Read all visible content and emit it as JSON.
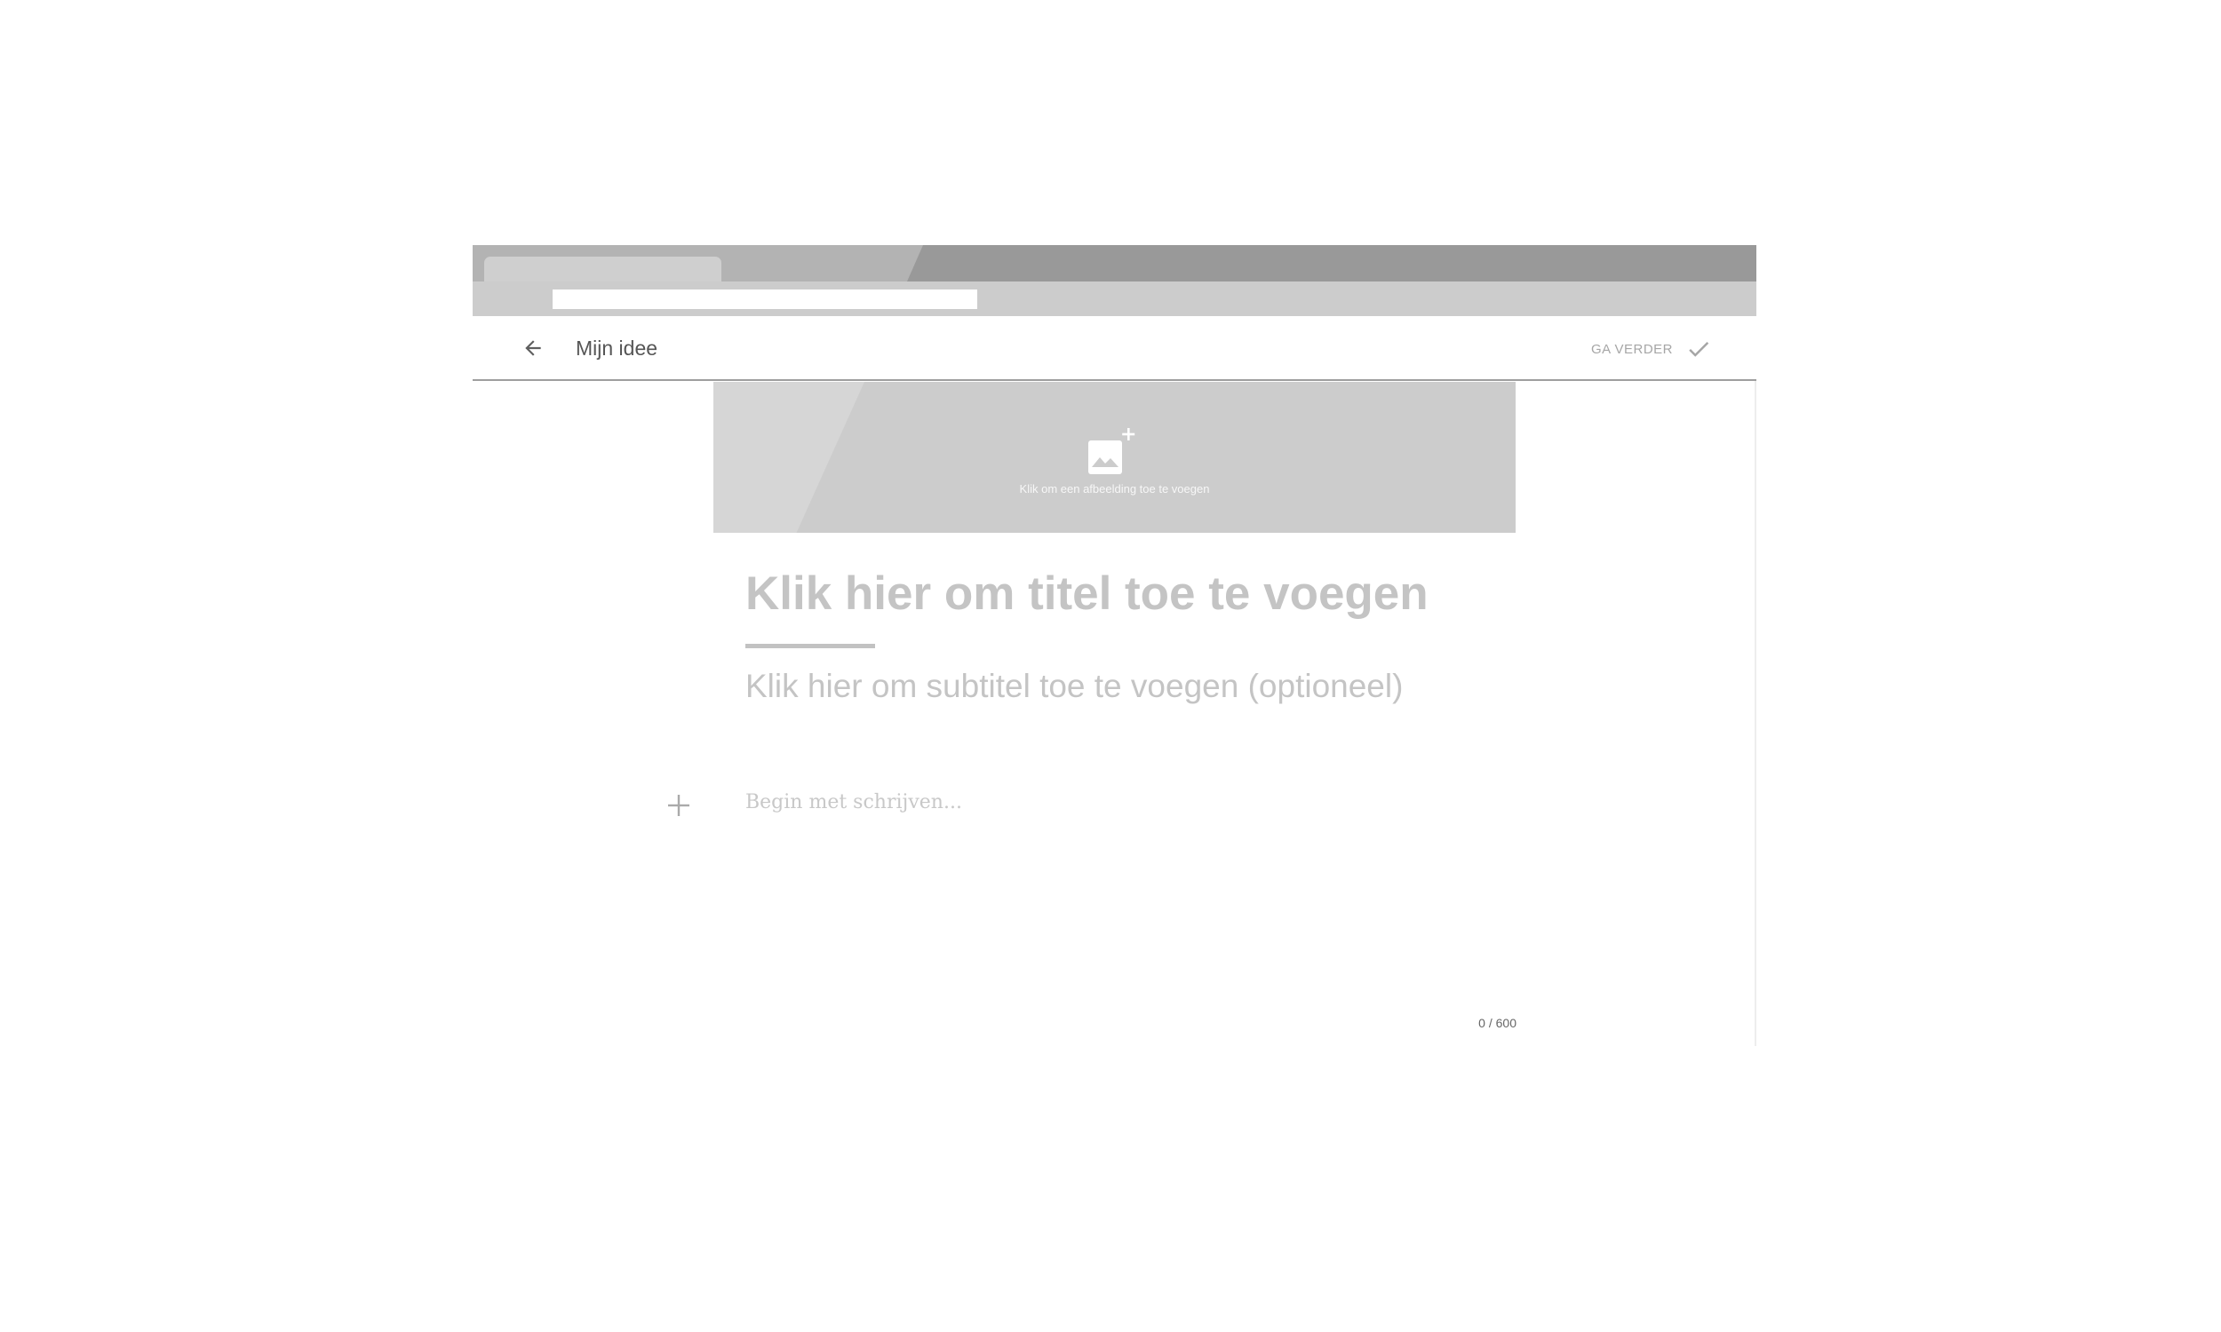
{
  "header": {
    "title": "Mijn idee",
    "continue_label": "GA VERDER"
  },
  "editor": {
    "image_prompt": "Klik om een afbeelding toe te voegen",
    "title_placeholder": "Klik hier om titel toe te voegen",
    "subtitle_placeholder": "Klik hier om subtitel toe te voegen (optioneel)",
    "body_placeholder": "Begin met schrijven...",
    "char_count": "0 / 600"
  },
  "icons": {
    "back": "arrow-left-icon",
    "continue": "checkmark-icon",
    "add_image": "add-photo-icon",
    "add_block": "plus-icon"
  },
  "colors": {
    "placeholder_text": "#c4c4c4",
    "header_border": "#9e9e9e",
    "image_area": "#cccccc"
  }
}
